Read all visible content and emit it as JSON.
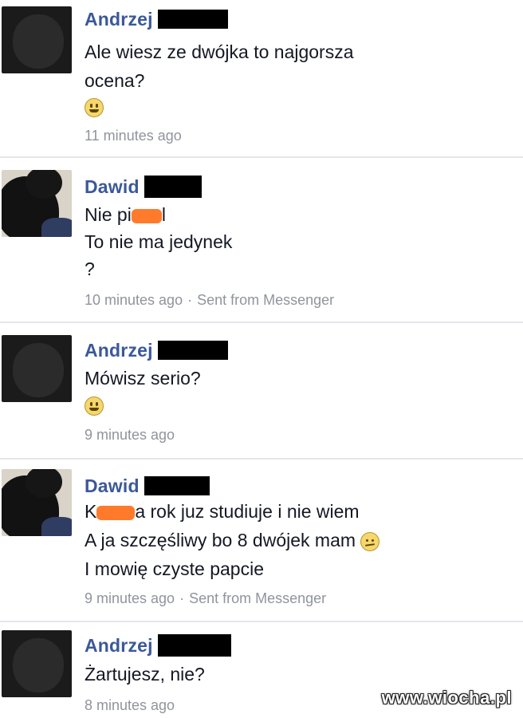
{
  "posts": [
    {
      "author": "Andrzej",
      "lines": [
        "Ale wiesz ze dwójka to najgorsza",
        "ocena?"
      ],
      "emoji": "smiley-icon",
      "time": "11 minutes ago",
      "via": ""
    },
    {
      "author": "Dawid",
      "lines": [
        "Nie pi",
        "l",
        "To nie ma jedynek",
        "?"
      ],
      "time": "10 minutes ago",
      "via": "Sent from Messenger"
    },
    {
      "author": "Andrzej",
      "lines": [
        "Mówisz serio?"
      ],
      "emoji": "smiley-icon",
      "time": "9 minutes ago",
      "via": ""
    },
    {
      "author": "Dawid",
      "lines": [
        "K",
        "a rok juz studiuje i nie wiem",
        "A ja szczęśliwy bo 8 dwójek mam",
        "I mowię czyste papcie"
      ],
      "emoji": "sad-smiley-icon",
      "time": "9 minutes ago",
      "via": "Sent from Messenger"
    },
    {
      "author": "Andrzej",
      "lines": [
        "Żartujesz, nie?"
      ],
      "time": "8 minutes ago",
      "via": ""
    }
  ],
  "separator": "·",
  "watermark": "www.wiocha.pl",
  "colors": {
    "name": "#3b5998",
    "meta": "#90949c",
    "censor": "#ff7a2b",
    "redaction": "#000000"
  }
}
